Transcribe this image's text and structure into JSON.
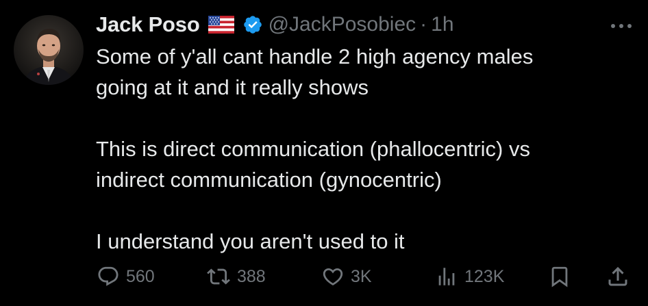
{
  "tweet": {
    "author": {
      "display_name": "Jack Poso",
      "handle": "@JackPosobiec",
      "flag_icon": "us-flag-icon",
      "verified_icon": "verified-badge-icon"
    },
    "separator": "·",
    "time": "1h",
    "text_paragraphs": [
      [
        "Some of y'all cant handle 2 high agency males",
        "going at it and it really shows"
      ],
      [
        "This is direct communication (phallocentric) vs",
        "indirect communication (gynocentric)"
      ],
      [
        "I understand you aren't used to it"
      ]
    ],
    "metrics": {
      "replies": "560",
      "reposts": "388",
      "likes": "3K",
      "views": "123K"
    }
  },
  "colors": {
    "background": "#000000",
    "text_primary": "#e7e9ea",
    "text_secondary": "#71767b",
    "verified_blue": "#1d9bf0"
  }
}
